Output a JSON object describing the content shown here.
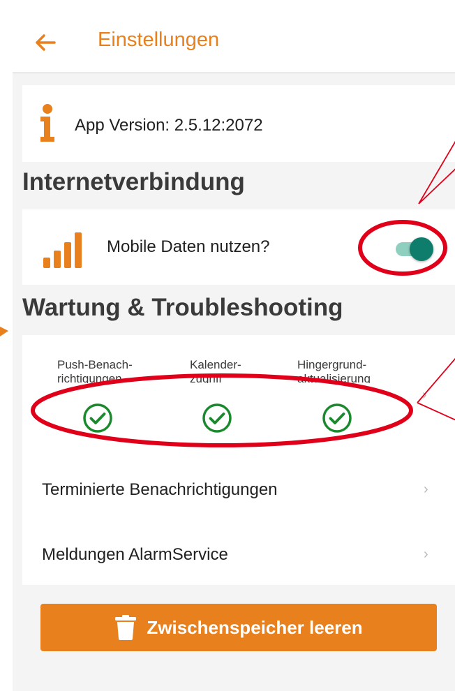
{
  "header": {
    "title": "Einstellungen"
  },
  "version_card": {
    "text": "App Version: 2.5.12:2072"
  },
  "internet_section": {
    "title": "Internetverbindung",
    "mobile_data_label": "Mobile Daten nutzen?",
    "mobile_data_enabled": true
  },
  "wartung_section": {
    "title": "Wartung & Troubleshooting",
    "permissions": [
      {
        "label_line1": "Push-Benach-",
        "label_line2": "richtigungen",
        "status": "granted"
      },
      {
        "label_line1": "Kalender-",
        "label_line2": "zugriff",
        "status": "granted"
      },
      {
        "label_line1": "Hingergrund-",
        "label_line2": "aktualisierung",
        "status": "granted"
      }
    ],
    "rows": [
      {
        "label": "Terminierte Benachrichtigungen"
      },
      {
        "label": "Meldungen AlarmService"
      }
    ]
  },
  "clear_button": {
    "label": "Zwischenspeicher leeren"
  },
  "icons": {
    "back": "arrow-left-icon",
    "info": "info-icon",
    "signal": "signal-bars-icon",
    "check": "check-circle-icon",
    "chevron": "chevron-right-icon",
    "trash": "trash-icon"
  },
  "colors": {
    "accent": "#e8801e",
    "toggle_on": "#0e7d6c",
    "check": "#1b8a2e",
    "annotation": "#e0001a"
  }
}
